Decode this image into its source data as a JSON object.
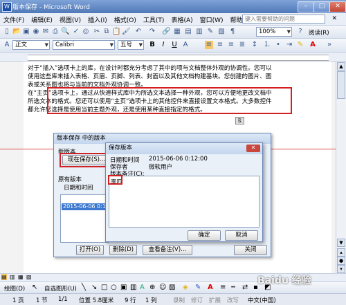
{
  "window": {
    "title": "版本保存 - Microsoft Word",
    "minimize": "–",
    "maximize": "□",
    "close": "✕"
  },
  "menu": {
    "items": [
      "文件(F)",
      "编辑(E)",
      "视图(V)",
      "插入(I)",
      "格式(O)",
      "工具(T)",
      "表格(A)",
      "窗口(W)",
      "帮助(H)"
    ],
    "help_placeholder": "键入需要帮助的问题"
  },
  "toolbar_standard": {
    "zoom": "100%",
    "read": "阅读(R)"
  },
  "toolbar_format": {
    "style": "正文",
    "font": "Calibri",
    "size": "五号"
  },
  "document": {
    "para1": "对于“插入”选项卡上的库，在设计时都充分考虑了其中的项与文档整体外观的协调性。您可以使用这些库来插入表格、页眉、页脚、列表、封面以及其他文档构建基块。您创建的图片、图表或关系图也将与当前的文档外观协调一致。",
    "para2": "在“主页”选项卡上，通过从快速样式库中为所选文本选择一种外观，您可以方便地更改文档中所选文本的格式。您还可以使用“主页”选项卡上的其他控件来直接设置文本格式。大多数控件都允许您选择是使用当前主题外观，还是使用某种直接指定的格式。"
  },
  "version_dialog": {
    "title": "版本保存 中的版本",
    "new_version": "新版本",
    "save_now": "现在保存(S)...",
    "existing": "原有版本",
    "col_datetime": "日期和时间",
    "row_datetime": "2015-06-06 0:11",
    "open": "打开(O)",
    "delete": "删除(D)",
    "view_comment": "查看备注(V)...",
    "close": "关闭"
  },
  "save_dialog": {
    "title": "保存版本",
    "datetime_label": "日期和时间",
    "datetime_value": "2015-06-06 0:12:00",
    "saver_label": "保存者",
    "saver_value": "微软用户",
    "comment_label": "版本备注(C):",
    "comment_value": "李四",
    "ok": "确定",
    "cancel": "取消"
  },
  "draw_toolbar": {
    "draw": "绘图(D)",
    "autoshapes": "自选图形(U)"
  },
  "status": {
    "page": "1 页",
    "section": "1 节",
    "pages": "1/1",
    "position": "位置 5.8厘米",
    "line": "9 行",
    "column": "1 列",
    "rec": "录制",
    "trk": "修订",
    "ext": "扩展",
    "ovr": "改写",
    "lang": "中文(中国)"
  },
  "watermark": "Baidu 经验"
}
